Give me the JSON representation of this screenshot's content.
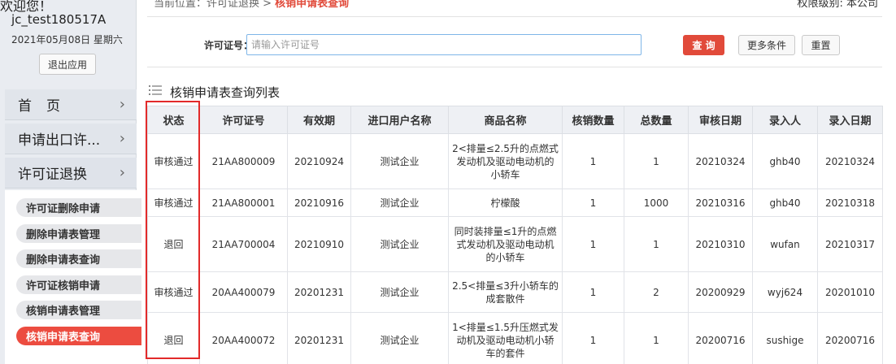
{
  "sidebar": {
    "welcome": "欢迎您！",
    "username": "jc_test180517A",
    "date": "2021年05月08日 星期六",
    "logout_label": "退出应用",
    "nav": [
      {
        "label": "首页"
      },
      {
        "label": "申请出口许..."
      },
      {
        "label": "许可证退换"
      }
    ],
    "sub_items": [
      {
        "label": "许可证删除申请"
      },
      {
        "label": "删除申请表管理"
      },
      {
        "label": "删除申请表查询"
      },
      {
        "label": "许可证核销申请"
      },
      {
        "label": "核销申请表管理"
      },
      {
        "label": "核销申请表查询"
      }
    ]
  },
  "header": {
    "breadcrumb_prefix": "当前位置：许可证退换 >",
    "breadcrumb_current": "核销申请表查询",
    "permission": "权限级别: 本公司"
  },
  "search": {
    "label": "许可证号：",
    "placeholder": "请输入许可证号",
    "value": "",
    "query_label": "查 询",
    "more_label": "更多条件",
    "reset_label": "重置"
  },
  "list": {
    "title": "核销申请表查询列表",
    "columns": [
      "状态",
      "许可证号",
      "有效期",
      "进口用户名称",
      "商品名称",
      "核销数量",
      "总数量",
      "审核日期",
      "录入人",
      "录入日期"
    ],
    "rows": [
      [
        "审核通过",
        "21AA800009",
        "20210924",
        "测试企业",
        "2<排量≤2.5升的点燃式发动机及驱动电动机的小轿车",
        "1",
        "1",
        "20210324",
        "ghb40",
        "20210324"
      ],
      [
        "审核通过",
        "21AA800001",
        "20210916",
        "测试企业",
        "柠檬酸",
        "1",
        "1000",
        "20210316",
        "ghb40",
        "20210318"
      ],
      [
        "退回",
        "21AA700004",
        "20210910",
        "测试企业",
        "同时装排量≤1升的点燃式发动机及驱动电动机的小轿车",
        "1",
        "1",
        "20210310",
        "wufan",
        "20210317"
      ],
      [
        "审核通过",
        "20AA400079",
        "20201231",
        "测试企业",
        "2.5<排量≤3升小轿车的成套散件",
        "1",
        "2",
        "20200929",
        "wyj624",
        "20201010"
      ],
      [
        "退回",
        "20AA400072",
        "20201231",
        "测试企业",
        "1<排量≤1.5升压燃式发动机及驱动电动机小轿车的套件",
        "1",
        "1",
        "20200716",
        "sushige",
        "20200716"
      ]
    ]
  },
  "colors": {
    "accent": "#e14a3a",
    "highlight": "#e22a2a",
    "sidebar_bg": "#e9ecf1",
    "header_bg": "#eef0f4"
  }
}
